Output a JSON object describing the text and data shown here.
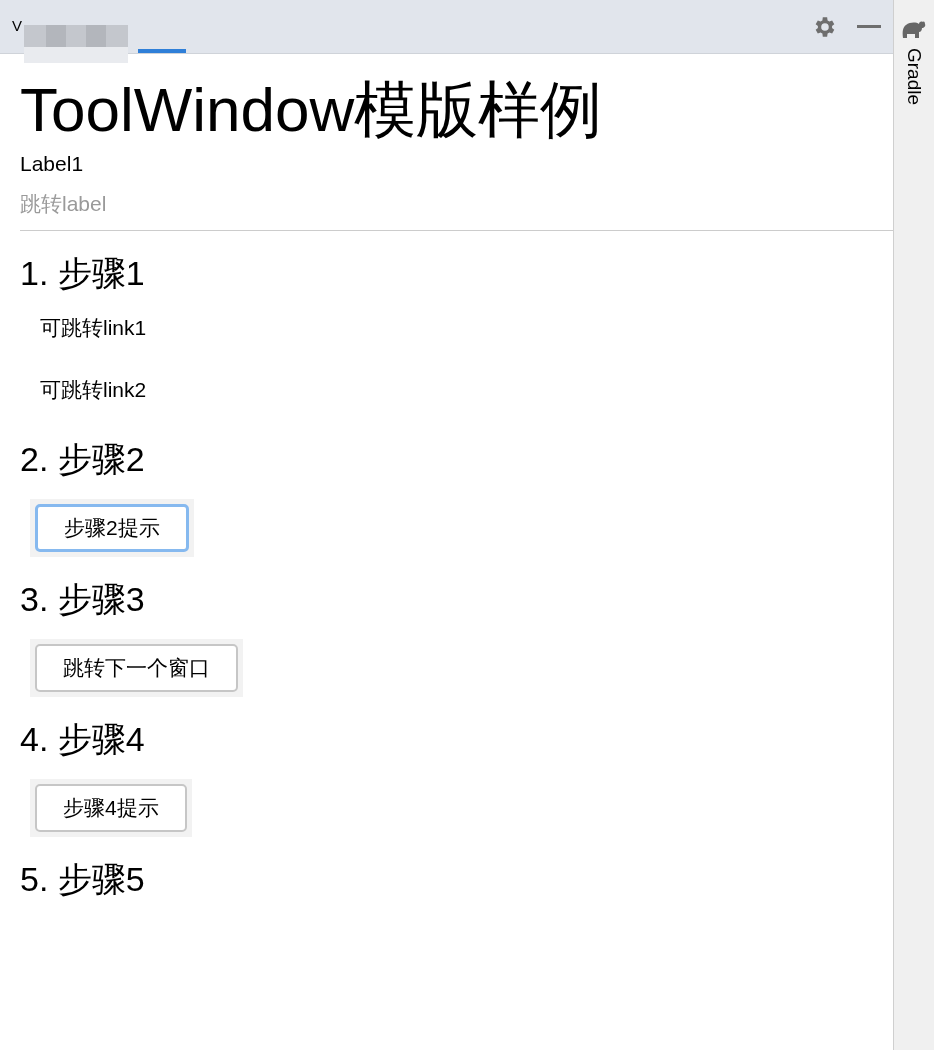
{
  "tool_window": {
    "tab": {
      "label": "V",
      "selected": true
    }
  },
  "side_panel": {
    "label": "Gradle"
  },
  "title": "ToolWindow模版样例",
  "label": "Label1",
  "link_label": "跳转label",
  "steps": [
    {
      "heading": "1. 步骤1",
      "kind": "links",
      "links": [
        "可跳转link1",
        "可跳转link2"
      ]
    },
    {
      "heading": "2. 步骤2",
      "kind": "button",
      "button": {
        "label": "步骤2提示",
        "focused": true
      }
    },
    {
      "heading": "3. 步骤3",
      "kind": "button",
      "button": {
        "label": "跳转下一个窗口",
        "focused": false
      }
    },
    {
      "heading": "4. 步骤4",
      "kind": "button",
      "button": {
        "label": "步骤4提示",
        "focused": false
      }
    },
    {
      "heading": "5. 步骤5",
      "kind": "empty"
    }
  ]
}
